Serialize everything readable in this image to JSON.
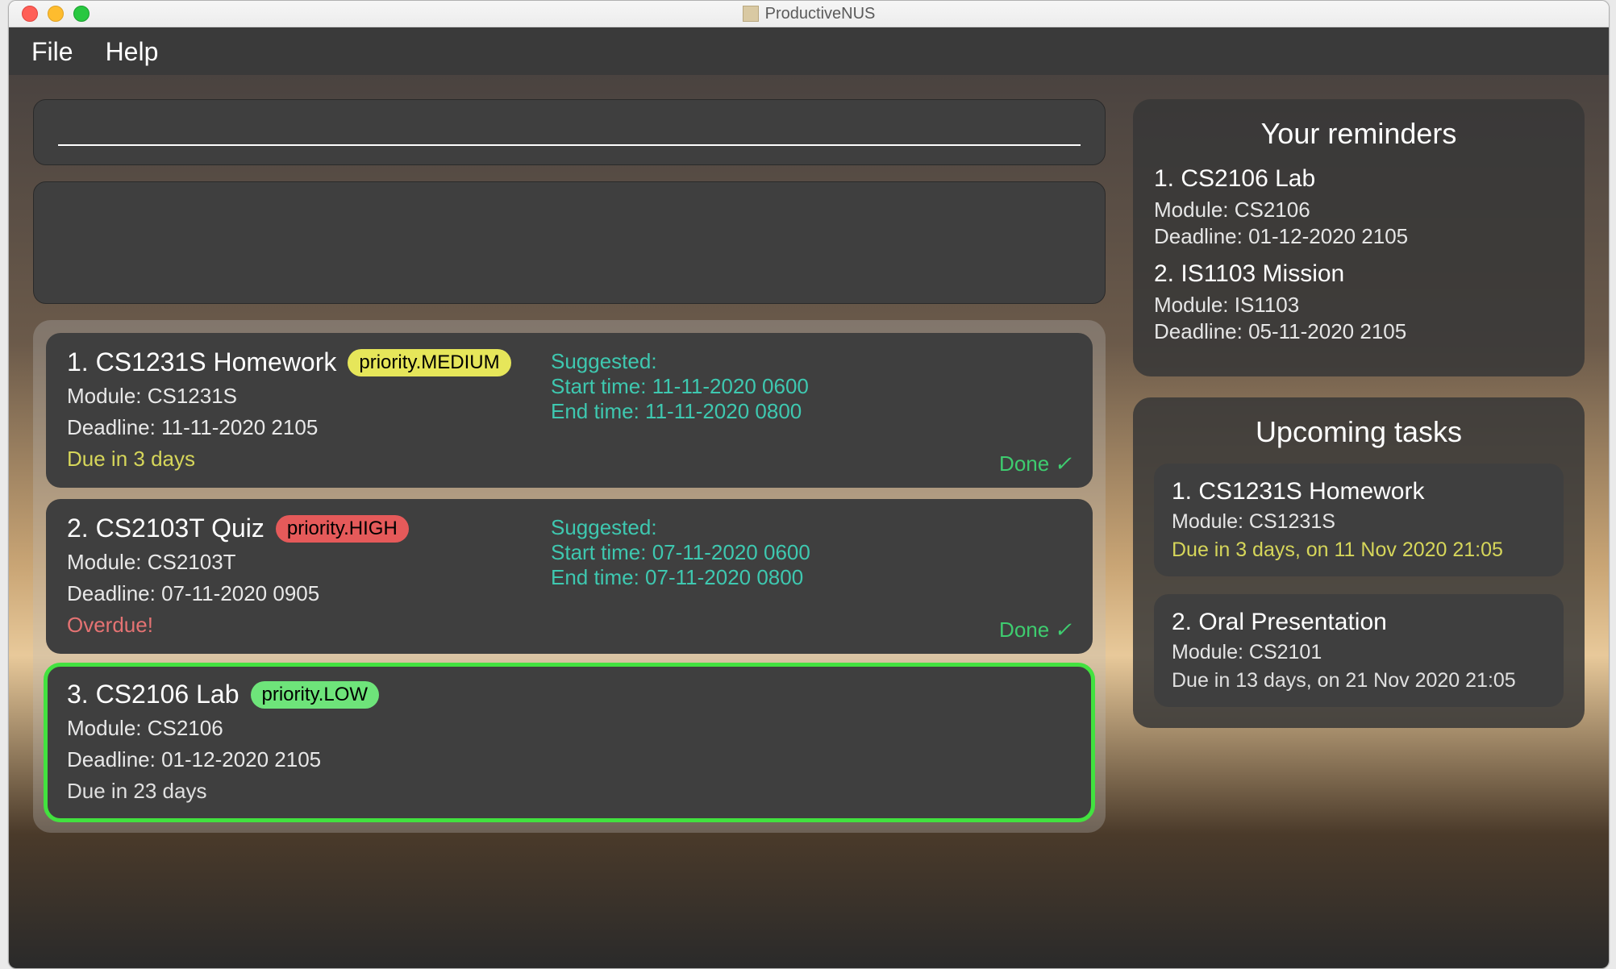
{
  "window": {
    "title": "ProductiveNUS"
  },
  "menubar": {
    "file": "File",
    "help": "Help"
  },
  "tasks": [
    {
      "title": "1.   CS1231S Homework",
      "priority_label": "priority.MEDIUM",
      "module": "Module: CS1231S",
      "deadline": "Deadline: 11-11-2020 2105",
      "due": "Due in 3 days",
      "due_class": "yellow",
      "suggested_title": "Suggested:",
      "suggested_start": "Start time: 11-11-2020 0600",
      "suggested_end": "End time: 11-11-2020 0800",
      "done": "Done"
    },
    {
      "title": "2.   CS2103T Quiz",
      "priority_label": "priority.HIGH",
      "module": "Module: CS2103T",
      "deadline": "Deadline: 07-11-2020 0905",
      "due": "Overdue!",
      "due_class": "red",
      "suggested_title": "Suggested:",
      "suggested_start": "Start time: 07-11-2020 0600",
      "suggested_end": "End time: 07-11-2020 0800",
      "done": "Done"
    },
    {
      "title": "3.   CS2106 Lab",
      "priority_label": "priority.LOW",
      "module": "Module: CS2106",
      "deadline": "Deadline: 01-12-2020 2105",
      "due": "Due in 23 days",
      "due_class": "gray"
    }
  ],
  "reminders": {
    "title": "Your reminders",
    "items": [
      {
        "title": "1.   CS2106 Lab",
        "module": "Module: CS2106",
        "deadline": "Deadline: 01-12-2020 2105"
      },
      {
        "title": "2.   IS1103 Mission",
        "module": "Module: IS1103",
        "deadline": "Deadline: 05-11-2020 2105"
      }
    ]
  },
  "upcoming": {
    "title": "Upcoming tasks",
    "items": [
      {
        "title": "1.   CS1231S Homework",
        "module": "Module: CS1231S",
        "due": "Due in 3 days, on 11 Nov 2020 21:05",
        "due_class": "yellow"
      },
      {
        "title": "2.   Oral Presentation",
        "module": "Module: CS2101",
        "due": "Due in 13 days, on 21 Nov 2020 21:05",
        "due_class": "gray"
      }
    ]
  }
}
